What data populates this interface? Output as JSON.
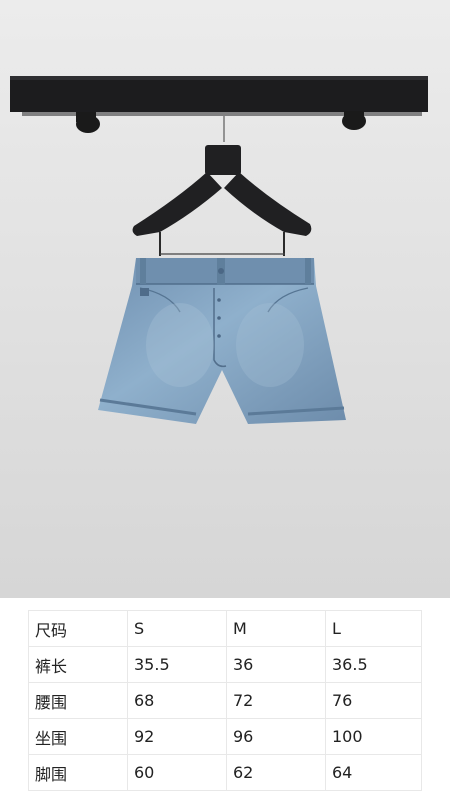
{
  "photo": {
    "subject": "denim shorts on hanger",
    "colors": {
      "wall": "#dedede",
      "shelf": "#1c1c1e",
      "hanger": "#202022",
      "denim": "#7d9cba",
      "denim_dark": "#5f7f9f"
    }
  },
  "size_table": {
    "header": {
      "label": "尺码",
      "s": "S",
      "m": "M",
      "l": "L"
    },
    "rows": [
      {
        "label": "裤长",
        "s": "35.5",
        "m": "36",
        "l": "36.5"
      },
      {
        "label": "腰围",
        "s": "68",
        "m": "72",
        "l": "76"
      },
      {
        "label": "坐围",
        "s": "92",
        "m": "96",
        "l": "100"
      },
      {
        "label": "脚围",
        "s": "60",
        "m": "62",
        "l": "64"
      }
    ]
  }
}
